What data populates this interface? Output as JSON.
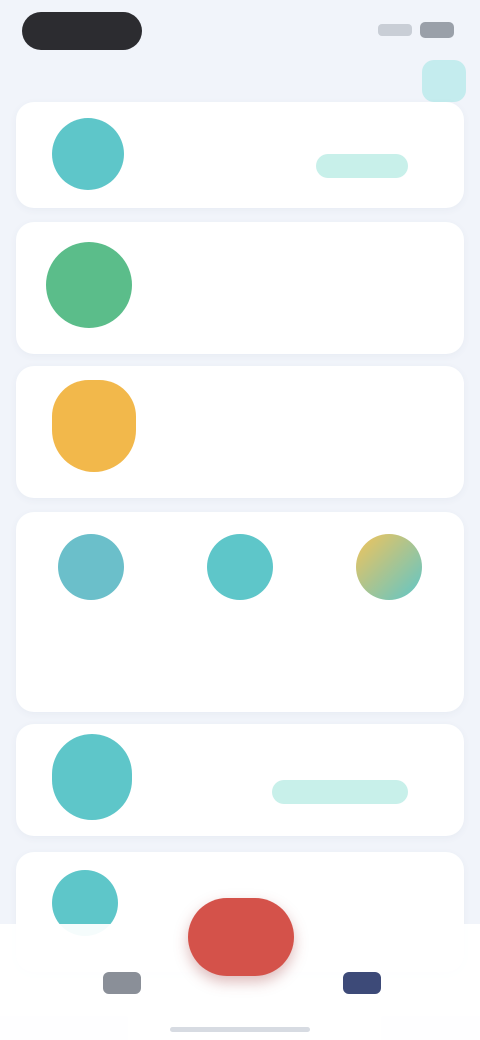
{
  "status_bar": {
    "time": ""
  },
  "header": {
    "title": ""
  },
  "cards": [
    {
      "title": "",
      "tag": ""
    },
    {
      "title": "",
      "value": ""
    },
    {
      "title": "",
      "value": ""
    },
    {
      "title": "",
      "tag": ""
    },
    {
      "title": ""
    }
  ],
  "grid": [
    {
      "label": ""
    },
    {
      "label": ""
    },
    {
      "label": ""
    }
  ],
  "nav": [
    {
      "label": ""
    },
    {
      "label": ""
    }
  ],
  "colors": {
    "accent_teal": "#5ec6c9",
    "accent_green": "#5bbd8a",
    "accent_orange": "#f2b84b",
    "fab_red": "#d4524a",
    "title_navy": "#3d4a78"
  }
}
